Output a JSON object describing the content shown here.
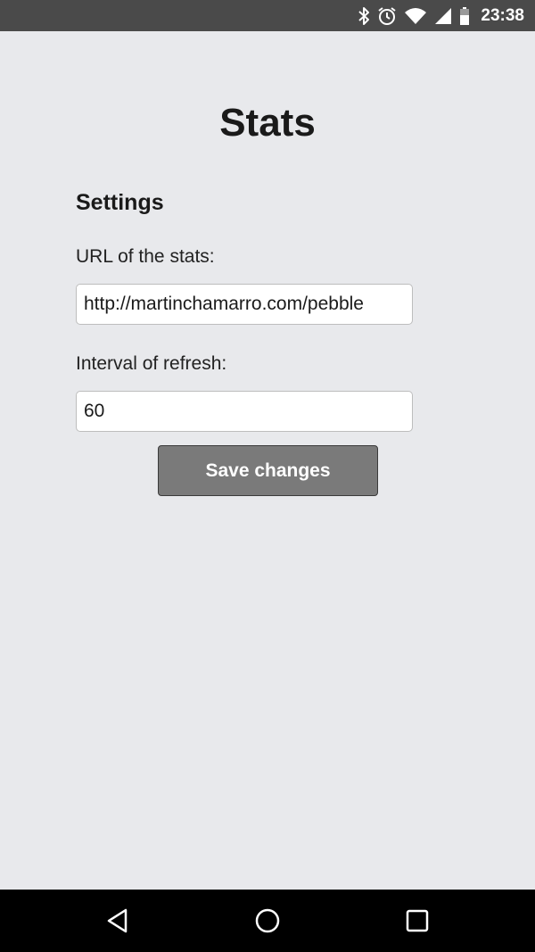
{
  "status_bar": {
    "time": "23:38",
    "icons": [
      "bluetooth-icon",
      "alarm-icon",
      "wifi-icon",
      "signal-icon",
      "battery-icon"
    ],
    "background_color": "#4a4a4a"
  },
  "page": {
    "title": "Stats",
    "section_heading": "Settings",
    "background_color": "#e8e9ec"
  },
  "form": {
    "url_label": "URL of the stats:",
    "url_value": "http://martinchamarro.com/pebble",
    "interval_label": "Interval of refresh:",
    "interval_value": "60",
    "save_label": "Save changes",
    "button_color": "#7a7a7a"
  },
  "nav_bar": {
    "icons": [
      "back-icon",
      "home-icon",
      "recents-icon"
    ],
    "background_color": "#000000"
  }
}
